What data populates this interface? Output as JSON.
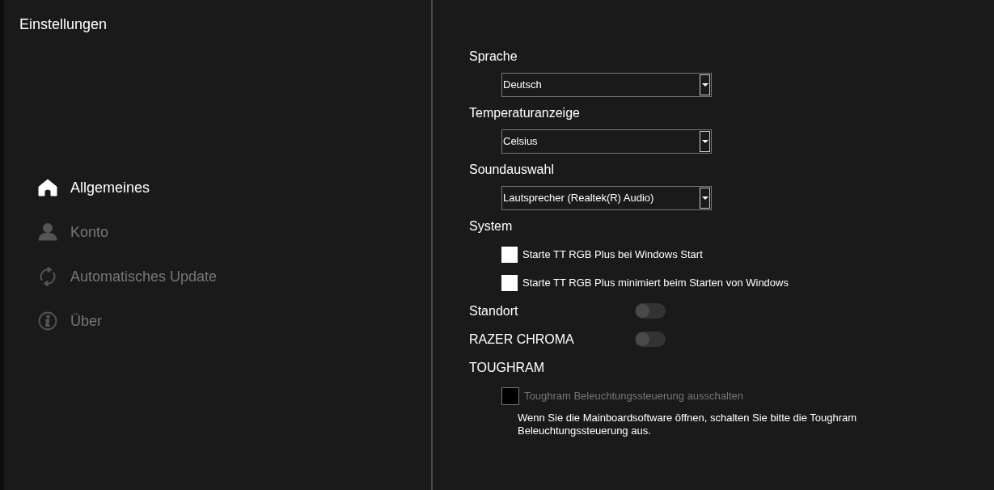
{
  "window": {
    "title": "Einstellungen"
  },
  "sidebar": {
    "items": [
      {
        "label": "Allgemeines",
        "kind": "home",
        "selected": true
      },
      {
        "label": "Konto",
        "kind": "account",
        "selected": false
      },
      {
        "label": "Automatisches Update",
        "kind": "update",
        "selected": false
      },
      {
        "label": "Über",
        "kind": "about",
        "selected": false
      }
    ]
  },
  "settings": [
    {
      "kind": "select",
      "label": "Sprache",
      "value": "Deutsch"
    },
    {
      "kind": "select",
      "label": "Temperaturanzeige",
      "value": "Celsius"
    },
    {
      "kind": "select",
      "label": "Soundauswahl",
      "value": "Lautsprecher (Realtek(R) Audio)"
    },
    {
      "kind": "checks",
      "label": "System",
      "options": [
        {
          "label": "Starte TT RGB Plus bei Windows Start",
          "checked": false,
          "disabled": false
        },
        {
          "label": "Starte TT RGB Plus minimiert beim Starten von Windows",
          "checked": false,
          "disabled": false
        }
      ]
    },
    {
      "kind": "toggle",
      "label": "Standort",
      "on": false
    },
    {
      "kind": "toggle",
      "label": "RAZER CHROMA",
      "on": false
    },
    {
      "kind": "checks",
      "label": "TOUGHRAM",
      "options": [
        {
          "label": "Toughram Beleuchtungssteuerung ausschalten",
          "checked": false,
          "disabled": true
        }
      ],
      "note": "Wenn Sie die Mainboardsoftware öffnen, schalten Sie bitte die Toughram Beleuchtungssteuerung aus."
    }
  ]
}
